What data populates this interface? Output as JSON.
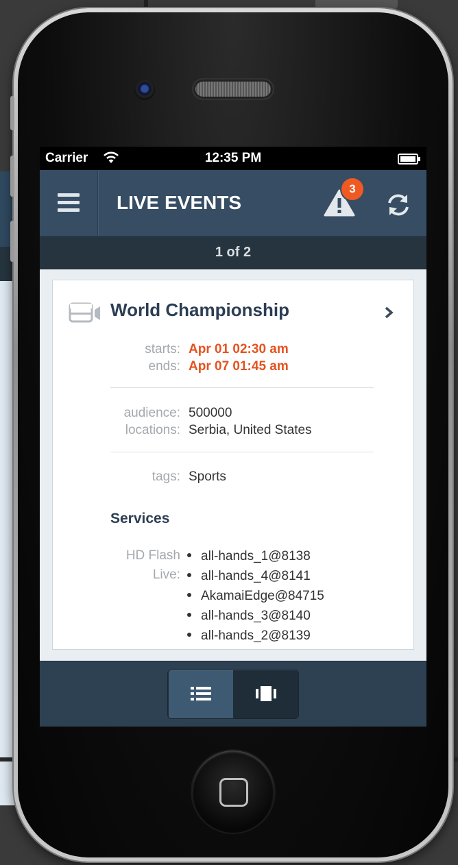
{
  "status_bar": {
    "carrier": "Carrier",
    "time": "12:35 PM",
    "wifi_icon": "wifi-icon",
    "battery_icon": "battery-icon"
  },
  "nav": {
    "title": "LIVE EVENTS",
    "alert_count": "3",
    "menu_icon": "hamburger-menu-icon",
    "alert_icon": "warning-icon",
    "refresh_icon": "refresh-icon"
  },
  "pager": {
    "text": "1 of 2"
  },
  "event": {
    "title": "World Championship",
    "starts_label": "starts:",
    "starts_value": "Apr 01 02:30 am",
    "ends_label": "ends:",
    "ends_value": "Apr 07 01:45 am",
    "audience_label": "audience:",
    "audience_value": "500000",
    "locations_label": "locations:",
    "locations_value": "Serbia, United States",
    "tags_label": "tags:",
    "tags_value": "Sports",
    "services_heading": "Services",
    "service_type_line1": "HD Flash",
    "service_type_line2": "Live:",
    "services": [
      "all-hands_1@8138",
      "all-hands_4@8141",
      "AkamaiEdge@84715",
      "all-hands_3@8140",
      "all-hands_2@8139"
    ]
  },
  "colors": {
    "navbar": "#364d63",
    "pager": "#26343f",
    "accent_orange": "#e6521f",
    "badge": "#f05a22",
    "title_text": "#2c3e53"
  },
  "tabbar": {
    "list_view_icon": "list-view-icon",
    "card_view_icon": "card-carousel-icon",
    "active": "list"
  }
}
